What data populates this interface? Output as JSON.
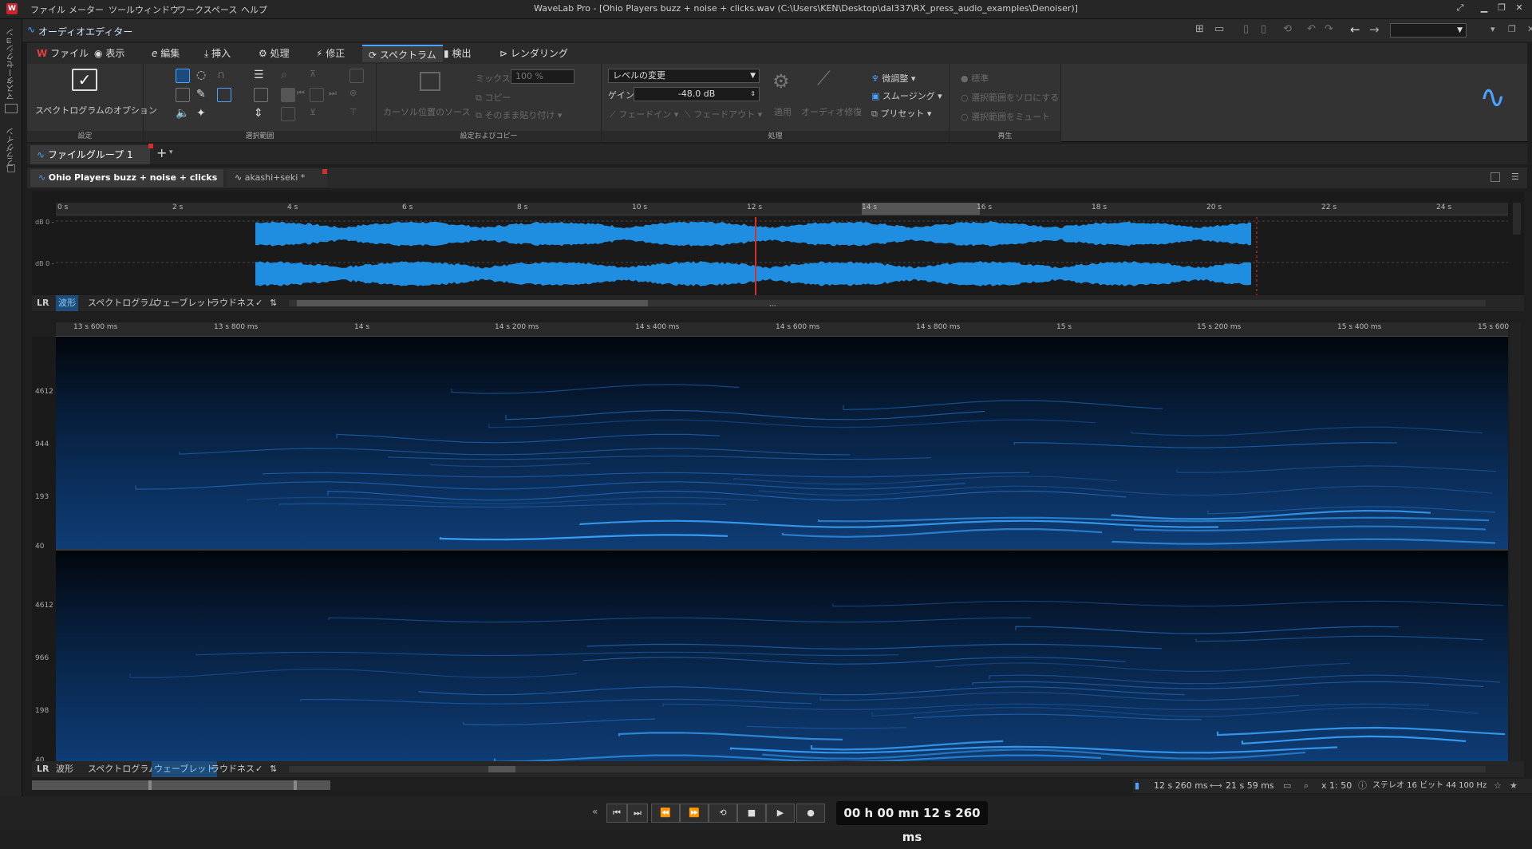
{
  "app": {
    "window_title": "WaveLab Pro - [Ohio Players buzz + noise + clicks.wav (C:\\Users\\KEN\\Desktop\\dal337\\RX_press_audio_examples\\Denoiser)]",
    "menu": [
      "ファイル",
      "メーター",
      "ツールウィンドウ",
      "ワークスペース",
      "ヘルプ"
    ],
    "editor_label": "オーディオエディター",
    "left_strip": [
      "マスターセクション",
      "プラグイン"
    ]
  },
  "ribbon_tabs": [
    {
      "label": "ファイル",
      "active": false
    },
    {
      "label": "表示",
      "active": false
    },
    {
      "label": "編集",
      "active": false
    },
    {
      "label": "挿入",
      "active": false
    },
    {
      "label": "処理",
      "active": false
    },
    {
      "label": "修正",
      "active": false
    },
    {
      "label": "スペクトラム",
      "active": true
    },
    {
      "label": "検出",
      "active": false
    },
    {
      "label": "レンダリング",
      "active": false
    }
  ],
  "ribbon": {
    "settings": {
      "button": "スペクトログラムのオプション",
      "group": "設定"
    },
    "selection": {
      "group": "選択範囲"
    },
    "source": {
      "cursor_source": "カーソル位置のソース",
      "mix_label": "ミックス",
      "mix_value": "100 %",
      "copy": "コピー",
      "paste": "そのまま貼り付け",
      "fade_in": "フェードイン",
      "fade_out": "フェードアウト",
      "group": "設定およびコピー"
    },
    "process": {
      "dropdown": "レベルの変更",
      "gain_label": "ゲイン",
      "gain_value": "-48.0 dB",
      "apply": "適用",
      "audio_repair": "オーディオ修復",
      "fine_tune": "微調整",
      "smoothing": "スムージング",
      "preset": "プリセット",
      "group": "処理"
    },
    "playback": {
      "standard": "標準",
      "solo": "選択範囲をソロにする",
      "mute": "選択範囲をミュート",
      "group": "再生"
    }
  },
  "file_group_tab": "ファイルグループ 1",
  "doc_tabs": [
    {
      "label": "Ohio Players buzz + noise + clicks",
      "active": true
    },
    {
      "label": "akashi+seki *",
      "active": false
    }
  ],
  "overview": {
    "ruler": [
      "0 s",
      "2 s",
      "4 s",
      "6 s",
      "8 s",
      "10 s",
      "12 s",
      "14 s",
      "16 s",
      "18 s",
      "20 s",
      "22 s",
      "24 s"
    ],
    "db_labels": [
      "dB 0 -",
      "dB 0 -"
    ]
  },
  "view_tabs": [
    "LR",
    "波形",
    "スペクトログラム",
    "ウェーブレット",
    "ラウドネス"
  ],
  "main_view": {
    "ruler": [
      "13 s 600 ms",
      "13 s 800 ms",
      "14 s",
      "14 s 200 ms",
      "14 s 400 ms",
      "14 s 600 ms",
      "14 s 800 ms",
      "15 s",
      "15 s 200 ms",
      "15 s 400 ms",
      "15 s 600"
    ],
    "freq_top": [
      "4612",
      "944",
      "193",
      "40"
    ],
    "freq_bottom": [
      "4612",
      "966",
      "198",
      "40"
    ]
  },
  "status": {
    "cursor": "12 s 260 ms",
    "length": "21 s 59 ms",
    "zoom": "x 1: 50",
    "format": "ステレオ 16 ビット 44 100 Hz"
  },
  "transport": {
    "timecode": "00 h 00 mn 12 s 260 ms"
  },
  "colors": {
    "accent": "#4aa3ff",
    "waveform": "#1f8ee0",
    "cursor": "#d03030"
  }
}
